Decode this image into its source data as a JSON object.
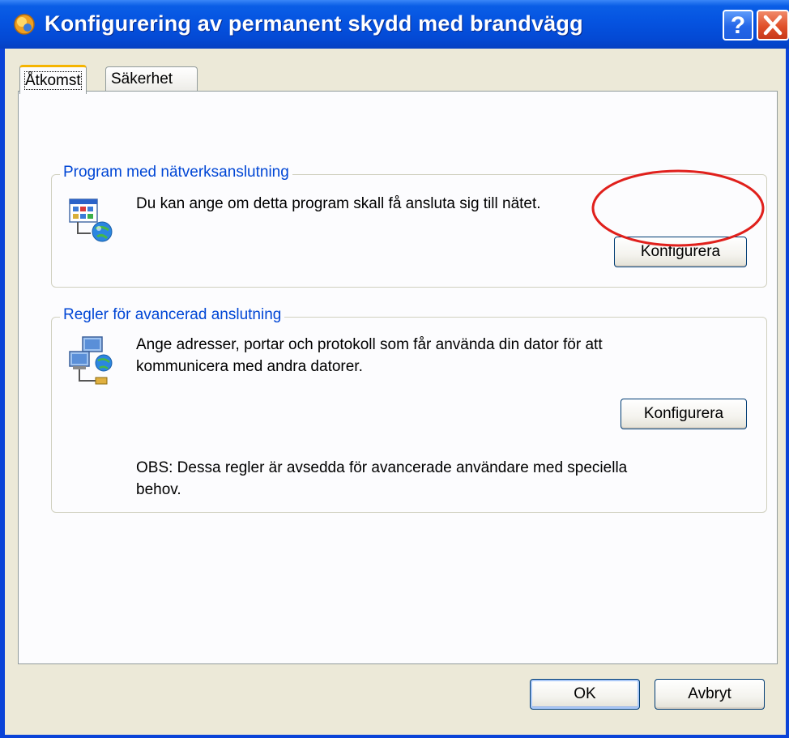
{
  "window": {
    "title": "Konfigurering av permanent skydd med brandvägg",
    "help_button": "?",
    "close_button": "✕"
  },
  "tabs": [
    {
      "label": "Åtkomst",
      "active": true
    },
    {
      "label": "Säkerhet",
      "active": false
    }
  ],
  "groups": {
    "program": {
      "title": "Program med nätverksanslutning",
      "description": "Du kan ange om detta program skall få ansluta sig till nätet.",
      "button": "Konfigurera",
      "icon": "application-network-icon"
    },
    "rules": {
      "title": "Regler för avancerad anslutning",
      "description_line1": "Ange adresser, portar och protokoll som får använda din dator för att",
      "description_line2": "kommunicera med andra datorer.",
      "button": "Konfigurera",
      "note_line1": "OBS: Dessa regler är avsedda för avancerade användare med speciella",
      "note_line2": "behov.",
      "icon": "networked-computers-icon"
    }
  },
  "footer": {
    "ok": "OK",
    "cancel": "Avbryt"
  },
  "annotation": {
    "type": "red-ellipse-highlight",
    "color": "#e0201c",
    "target": "program-configure-button"
  },
  "colors": {
    "titlebar": "#0553e0",
    "group_title": "#0046d5",
    "dialog_background": "#ece9d8",
    "tab_accent": "#f5b400"
  }
}
